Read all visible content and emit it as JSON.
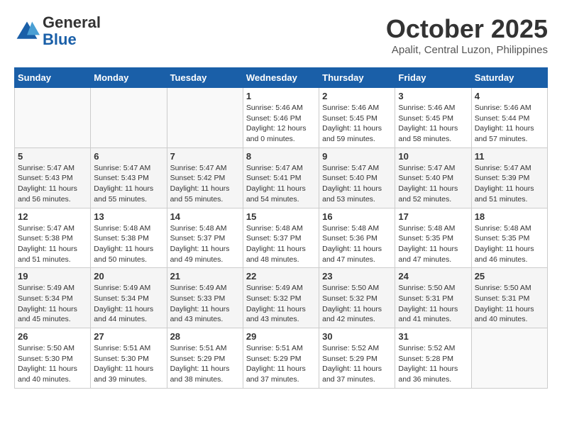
{
  "header": {
    "logo_line1": "General",
    "logo_line2": "Blue",
    "month": "October 2025",
    "location": "Apalit, Central Luzon, Philippines"
  },
  "weekdays": [
    "Sunday",
    "Monday",
    "Tuesday",
    "Wednesday",
    "Thursday",
    "Friday",
    "Saturday"
  ],
  "weeks": [
    [
      {
        "day": "",
        "sunrise": "",
        "sunset": "",
        "daylight": ""
      },
      {
        "day": "",
        "sunrise": "",
        "sunset": "",
        "daylight": ""
      },
      {
        "day": "",
        "sunrise": "",
        "sunset": "",
        "daylight": ""
      },
      {
        "day": "1",
        "sunrise": "Sunrise: 5:46 AM",
        "sunset": "Sunset: 5:46 PM",
        "daylight": "Daylight: 12 hours and 0 minutes."
      },
      {
        "day": "2",
        "sunrise": "Sunrise: 5:46 AM",
        "sunset": "Sunset: 5:45 PM",
        "daylight": "Daylight: 11 hours and 59 minutes."
      },
      {
        "day": "3",
        "sunrise": "Sunrise: 5:46 AM",
        "sunset": "Sunset: 5:45 PM",
        "daylight": "Daylight: 11 hours and 58 minutes."
      },
      {
        "day": "4",
        "sunrise": "Sunrise: 5:46 AM",
        "sunset": "Sunset: 5:44 PM",
        "daylight": "Daylight: 11 hours and 57 minutes."
      }
    ],
    [
      {
        "day": "5",
        "sunrise": "Sunrise: 5:47 AM",
        "sunset": "Sunset: 5:43 PM",
        "daylight": "Daylight: 11 hours and 56 minutes."
      },
      {
        "day": "6",
        "sunrise": "Sunrise: 5:47 AM",
        "sunset": "Sunset: 5:43 PM",
        "daylight": "Daylight: 11 hours and 55 minutes."
      },
      {
        "day": "7",
        "sunrise": "Sunrise: 5:47 AM",
        "sunset": "Sunset: 5:42 PM",
        "daylight": "Daylight: 11 hours and 55 minutes."
      },
      {
        "day": "8",
        "sunrise": "Sunrise: 5:47 AM",
        "sunset": "Sunset: 5:41 PM",
        "daylight": "Daylight: 11 hours and 54 minutes."
      },
      {
        "day": "9",
        "sunrise": "Sunrise: 5:47 AM",
        "sunset": "Sunset: 5:40 PM",
        "daylight": "Daylight: 11 hours and 53 minutes."
      },
      {
        "day": "10",
        "sunrise": "Sunrise: 5:47 AM",
        "sunset": "Sunset: 5:40 PM",
        "daylight": "Daylight: 11 hours and 52 minutes."
      },
      {
        "day": "11",
        "sunrise": "Sunrise: 5:47 AM",
        "sunset": "Sunset: 5:39 PM",
        "daylight": "Daylight: 11 hours and 51 minutes."
      }
    ],
    [
      {
        "day": "12",
        "sunrise": "Sunrise: 5:47 AM",
        "sunset": "Sunset: 5:38 PM",
        "daylight": "Daylight: 11 hours and 51 minutes."
      },
      {
        "day": "13",
        "sunrise": "Sunrise: 5:48 AM",
        "sunset": "Sunset: 5:38 PM",
        "daylight": "Daylight: 11 hours and 50 minutes."
      },
      {
        "day": "14",
        "sunrise": "Sunrise: 5:48 AM",
        "sunset": "Sunset: 5:37 PM",
        "daylight": "Daylight: 11 hours and 49 minutes."
      },
      {
        "day": "15",
        "sunrise": "Sunrise: 5:48 AM",
        "sunset": "Sunset: 5:37 PM",
        "daylight": "Daylight: 11 hours and 48 minutes."
      },
      {
        "day": "16",
        "sunrise": "Sunrise: 5:48 AM",
        "sunset": "Sunset: 5:36 PM",
        "daylight": "Daylight: 11 hours and 47 minutes."
      },
      {
        "day": "17",
        "sunrise": "Sunrise: 5:48 AM",
        "sunset": "Sunset: 5:35 PM",
        "daylight": "Daylight: 11 hours and 47 minutes."
      },
      {
        "day": "18",
        "sunrise": "Sunrise: 5:48 AM",
        "sunset": "Sunset: 5:35 PM",
        "daylight": "Daylight: 11 hours and 46 minutes."
      }
    ],
    [
      {
        "day": "19",
        "sunrise": "Sunrise: 5:49 AM",
        "sunset": "Sunset: 5:34 PM",
        "daylight": "Daylight: 11 hours and 45 minutes."
      },
      {
        "day": "20",
        "sunrise": "Sunrise: 5:49 AM",
        "sunset": "Sunset: 5:34 PM",
        "daylight": "Daylight: 11 hours and 44 minutes."
      },
      {
        "day": "21",
        "sunrise": "Sunrise: 5:49 AM",
        "sunset": "Sunset: 5:33 PM",
        "daylight": "Daylight: 11 hours and 43 minutes."
      },
      {
        "day": "22",
        "sunrise": "Sunrise: 5:49 AM",
        "sunset": "Sunset: 5:32 PM",
        "daylight": "Daylight: 11 hours and 43 minutes."
      },
      {
        "day": "23",
        "sunrise": "Sunrise: 5:50 AM",
        "sunset": "Sunset: 5:32 PM",
        "daylight": "Daylight: 11 hours and 42 minutes."
      },
      {
        "day": "24",
        "sunrise": "Sunrise: 5:50 AM",
        "sunset": "Sunset: 5:31 PM",
        "daylight": "Daylight: 11 hours and 41 minutes."
      },
      {
        "day": "25",
        "sunrise": "Sunrise: 5:50 AM",
        "sunset": "Sunset: 5:31 PM",
        "daylight": "Daylight: 11 hours and 40 minutes."
      }
    ],
    [
      {
        "day": "26",
        "sunrise": "Sunrise: 5:50 AM",
        "sunset": "Sunset: 5:30 PM",
        "daylight": "Daylight: 11 hours and 40 minutes."
      },
      {
        "day": "27",
        "sunrise": "Sunrise: 5:51 AM",
        "sunset": "Sunset: 5:30 PM",
        "daylight": "Daylight: 11 hours and 39 minutes."
      },
      {
        "day": "28",
        "sunrise": "Sunrise: 5:51 AM",
        "sunset": "Sunset: 5:29 PM",
        "daylight": "Daylight: 11 hours and 38 minutes."
      },
      {
        "day": "29",
        "sunrise": "Sunrise: 5:51 AM",
        "sunset": "Sunset: 5:29 PM",
        "daylight": "Daylight: 11 hours and 37 minutes."
      },
      {
        "day": "30",
        "sunrise": "Sunrise: 5:52 AM",
        "sunset": "Sunset: 5:29 PM",
        "daylight": "Daylight: 11 hours and 37 minutes."
      },
      {
        "day": "31",
        "sunrise": "Sunrise: 5:52 AM",
        "sunset": "Sunset: 5:28 PM",
        "daylight": "Daylight: 11 hours and 36 minutes."
      },
      {
        "day": "",
        "sunrise": "",
        "sunset": "",
        "daylight": ""
      }
    ]
  ]
}
